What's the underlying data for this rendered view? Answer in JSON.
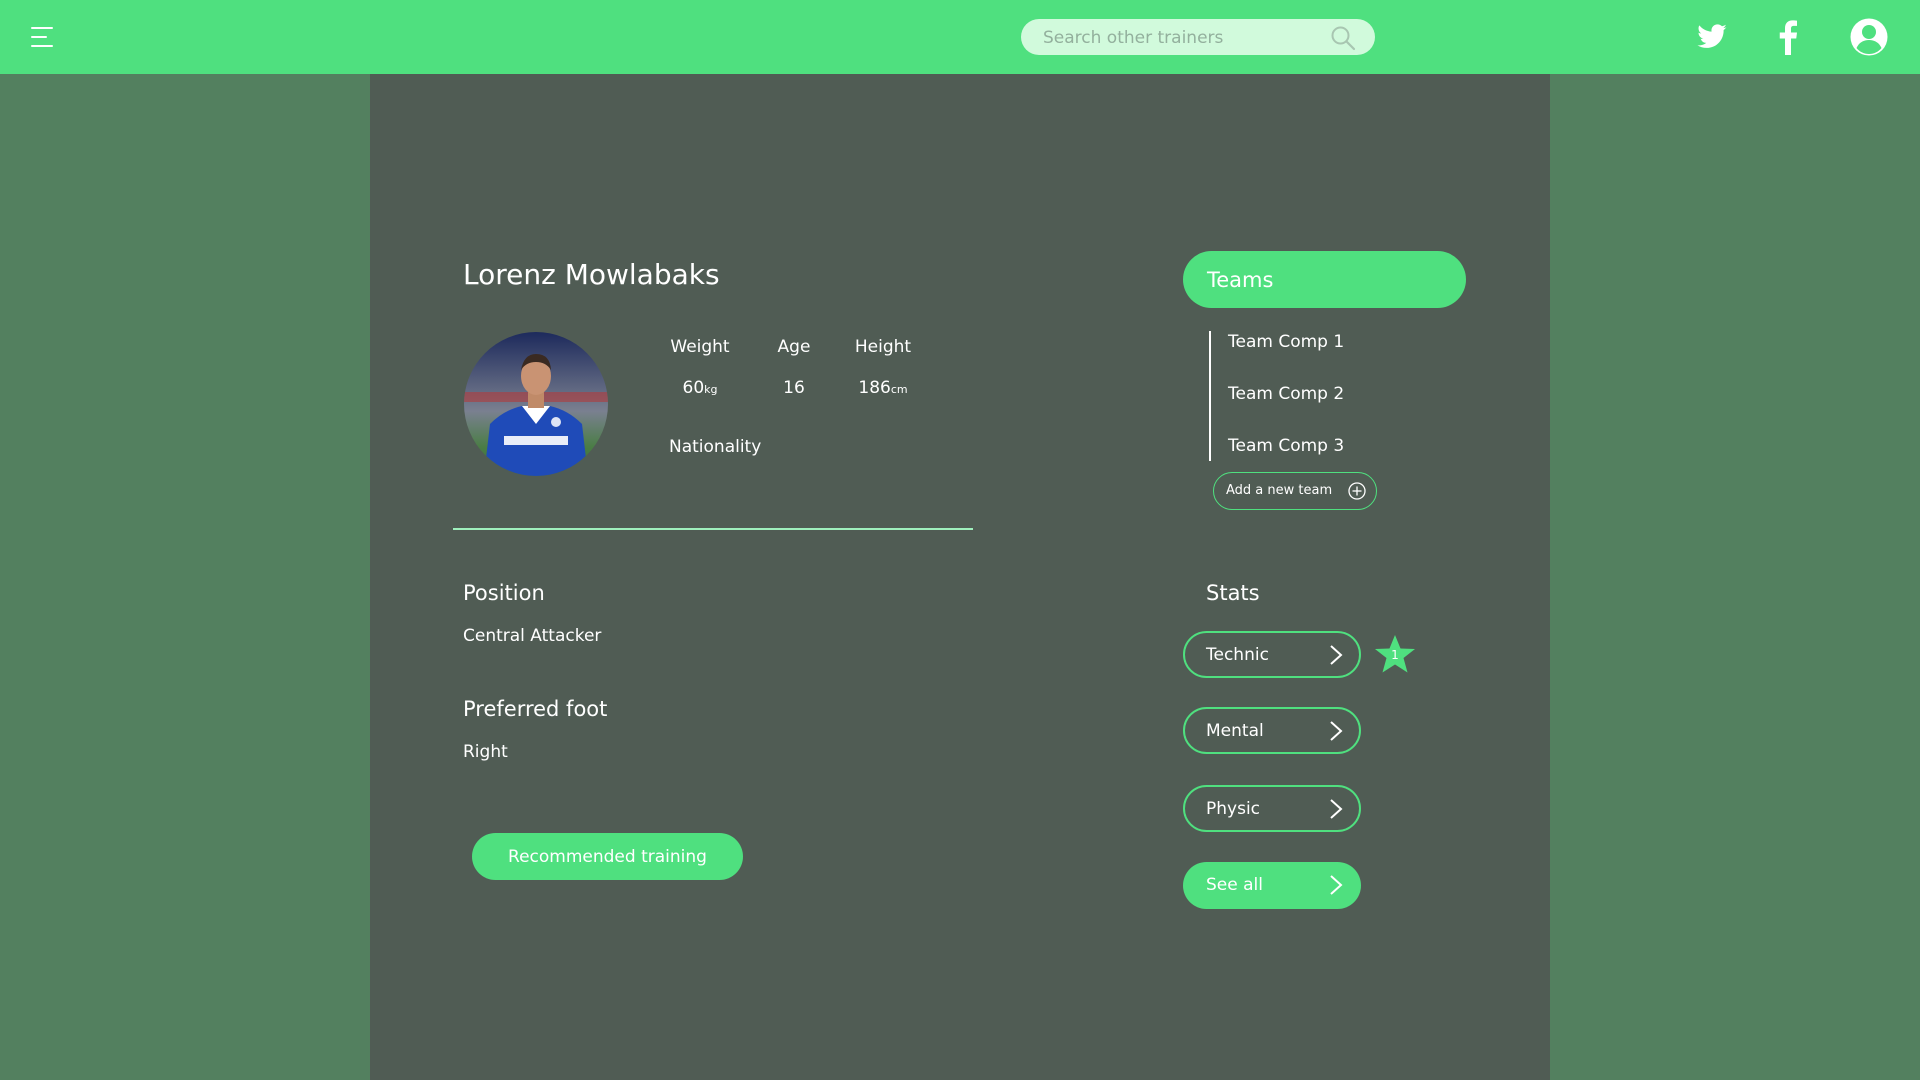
{
  "header": {
    "search_placeholder": "Search other trainers",
    "icons": [
      "menu-icon",
      "search-icon",
      "twitter-icon",
      "facebook-icon",
      "user-account-icon"
    ]
  },
  "player": {
    "name": "Lorenz Mowlabaks",
    "stats": [
      {
        "label": "Weight",
        "value": "60",
        "unit": "kg"
      },
      {
        "label": "Age",
        "value": "16",
        "unit": ""
      },
      {
        "label": "Height",
        "value": "186",
        "unit": "cm"
      }
    ],
    "nationality_label": "Nationality",
    "position_label": "Position",
    "position_value": "Central Attacker",
    "foot_label": "Preferred foot",
    "foot_value": "Right",
    "recommended_label": "Recommended training"
  },
  "teams": {
    "header": "Teams",
    "items": [
      "Team Comp 1",
      "Team Comp 2",
      "Team Comp 3"
    ],
    "add_label": "Add a new team"
  },
  "stats": {
    "header": "Stats",
    "buttons": [
      "Technic",
      "Mental",
      "Physic"
    ],
    "see_all_label": "See all",
    "badge_value": "1"
  },
  "colors": {
    "accent": "#4fe07f",
    "background": "#53805f",
    "panel": "#505c54",
    "search_bg": "#d1fadc"
  }
}
